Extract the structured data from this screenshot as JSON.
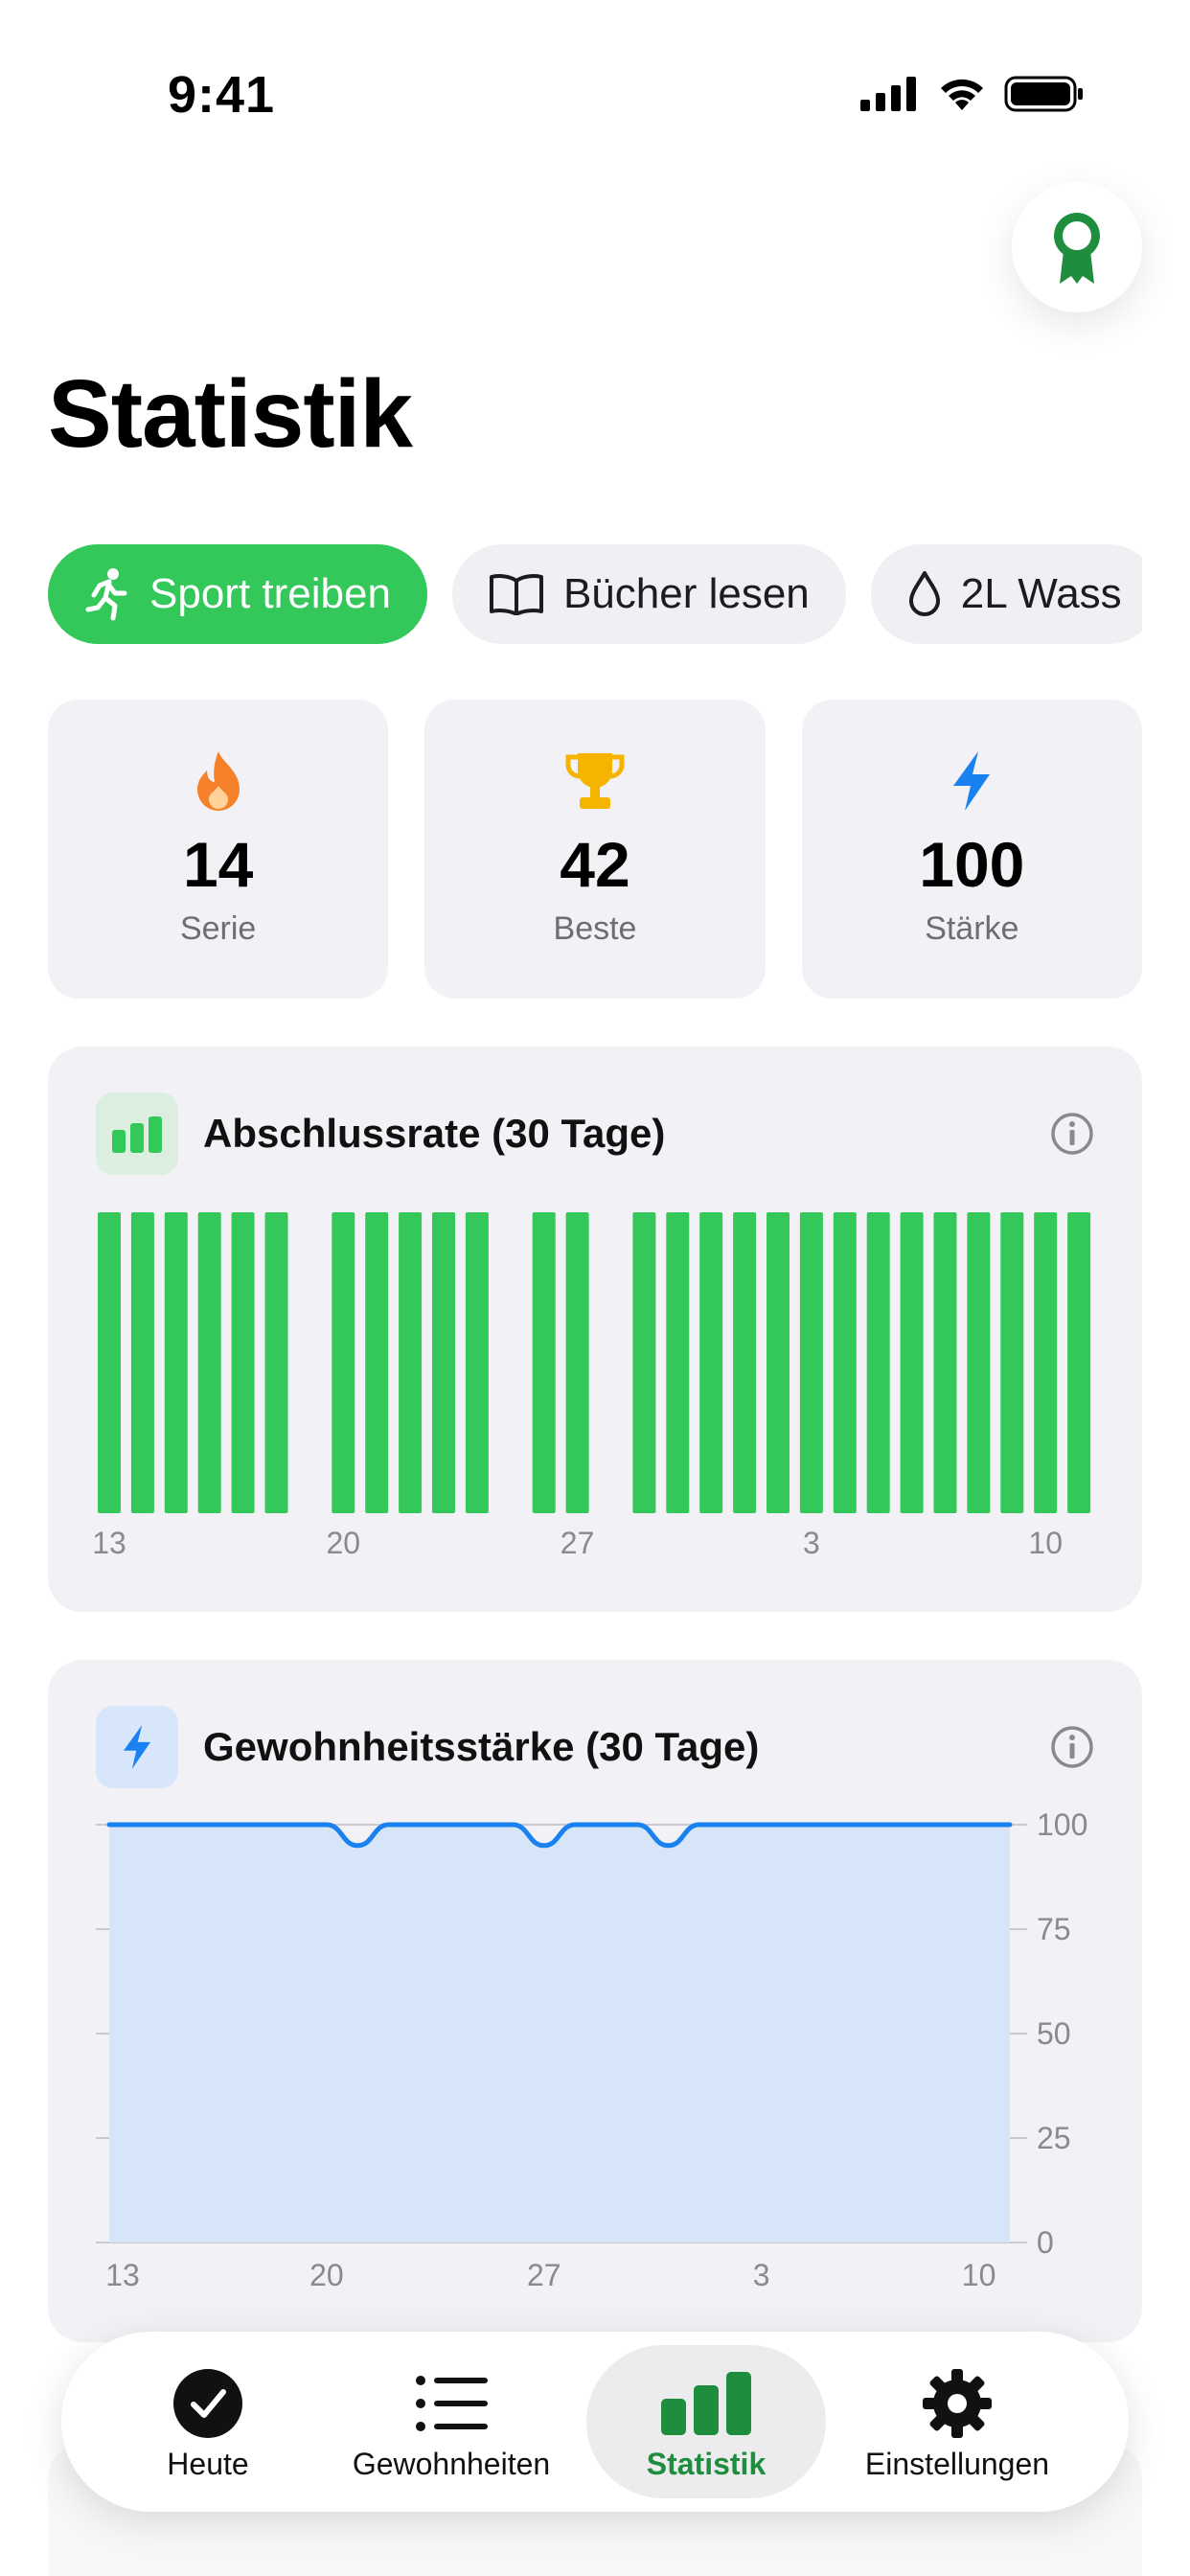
{
  "status_bar": {
    "time": "9:41"
  },
  "page": {
    "title": "Statistik"
  },
  "habits": [
    {
      "label": "Sport treiben",
      "icon": "running-icon",
      "selected": true
    },
    {
      "label": "Bücher lesen",
      "icon": "book-icon",
      "selected": false
    },
    {
      "label": "2L Wass",
      "icon": "water-drop-icon",
      "selected": false
    }
  ],
  "stats": [
    {
      "value": "14",
      "label": "Serie",
      "icon": "flame-icon"
    },
    {
      "value": "42",
      "label": "Beste",
      "icon": "trophy-icon"
    },
    {
      "value": "100",
      "label": "Stärke",
      "icon": "bolt-icon"
    }
  ],
  "completion_card": {
    "title": "Abschlussrate (30 Tage)"
  },
  "strength_card": {
    "title": "Gewohnheitsstärke (30 Tage)"
  },
  "colors": {
    "accent_green": "#34c759",
    "accent_blue": "#1a82f0",
    "active_tab_green": "#1e8e3e"
  },
  "chart_data": [
    {
      "type": "bar",
      "title": "Abschlussrate (30 Tage)",
      "x_tick_labels": [
        "13",
        "20",
        "27",
        "3",
        "10"
      ],
      "days": [
        "13",
        "14",
        "15",
        "16",
        "17",
        "18",
        "19",
        "20",
        "21",
        "22",
        "23",
        "24",
        "25",
        "26",
        "27",
        "28",
        "29",
        "30",
        "1",
        "2",
        "3",
        "4",
        "5",
        "6",
        "7",
        "8",
        "9",
        "10",
        "11",
        "12"
      ],
      "values": [
        1,
        1,
        1,
        1,
        1,
        1,
        0,
        1,
        1,
        1,
        1,
        1,
        0,
        1,
        1,
        0,
        1,
        1,
        1,
        1,
        1,
        1,
        1,
        1,
        1,
        1,
        1,
        1,
        1,
        1
      ],
      "ylim": [
        0,
        1
      ]
    },
    {
      "type": "area",
      "title": "Gewohnheitsstärke (30 Tage)",
      "x_tick_labels": [
        "13",
        "20",
        "27",
        "3",
        "10"
      ],
      "y_tick_labels": [
        "100",
        "75",
        "50",
        "25",
        "0"
      ],
      "values": [
        100,
        100,
        100,
        100,
        100,
        100,
        100,
        100,
        95,
        100,
        100,
        100,
        100,
        100,
        95,
        100,
        100,
        100,
        95,
        100,
        100,
        100,
        100,
        100,
        100,
        100,
        100,
        100,
        100,
        100
      ],
      "ylim": [
        0,
        100
      ],
      "grid": true
    }
  ],
  "tabbar": {
    "items": [
      {
        "label": "Heute",
        "icon": "checkmark-circle-icon",
        "active": false
      },
      {
        "label": "Gewohnheiten",
        "icon": "list-icon",
        "active": false
      },
      {
        "label": "Statistik",
        "icon": "bar-chart-icon",
        "active": true
      },
      {
        "label": "Einstellungen",
        "icon": "gear-icon",
        "active": false
      }
    ]
  }
}
